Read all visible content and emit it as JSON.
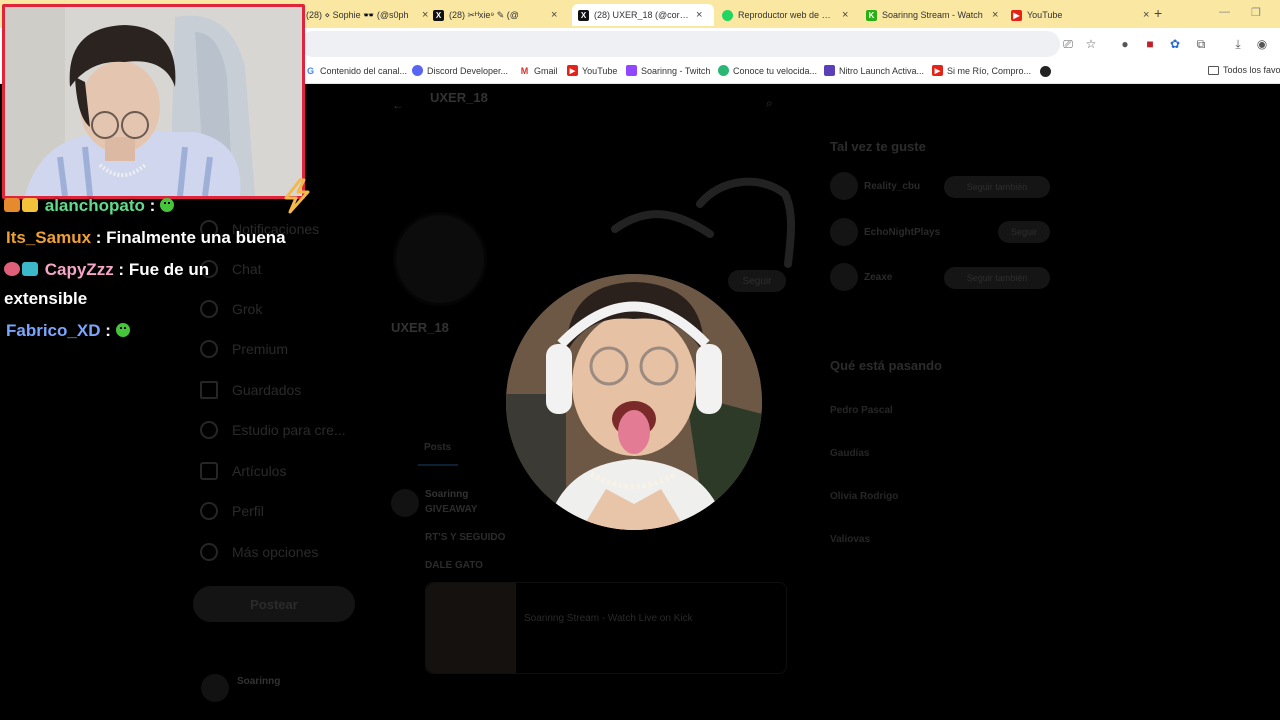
{
  "browser": {
    "tabs": [
      {
        "label": "(28) ⋄ Sophie 🕶️ (@s0ph",
        "favicon": "x-icon",
        "active": false
      },
      {
        "label": "(28) ✂︎ᴴxie⁹ ✎ (@",
        "favicon": "x-icon",
        "active": false
      },
      {
        "label": "(28) UXER_18 (@correa_u",
        "favicon": "x-icon",
        "active": true
      },
      {
        "label": "Reproductor web de Spo",
        "favicon": "spotify-icon",
        "active": false
      },
      {
        "label": "Soarinng Stream - Watch",
        "favicon": "kick-icon",
        "active": false
      },
      {
        "label": "YouTube",
        "favicon": "youtube-icon",
        "active": false
      }
    ],
    "bookmarks": [
      {
        "label": "Contenido del canal...",
        "favicon": "google-icon"
      },
      {
        "label": "Discord Developer...",
        "favicon": "discord-icon"
      },
      {
        "label": "Gmail",
        "favicon": "gmail-icon"
      },
      {
        "label": "YouTube",
        "favicon": "youtube-icon"
      },
      {
        "label": "Soarinng - Twitch",
        "favicon": "twitch-icon"
      },
      {
        "label": "Conoce tu velocida...",
        "favicon": "speedtest-icon"
      },
      {
        "label": "Nitro Launch Activa...",
        "favicon": "nitro-icon"
      },
      {
        "label": "Si me Río, Compro...",
        "favicon": "youtube-icon"
      },
      {
        "label": "Todos los favor",
        "favicon": "folder-icon"
      }
    ]
  },
  "profile_page": {
    "header_name": "UXER_18",
    "display_name": "UXER_18",
    "follow_label": "Seguir",
    "tab_posts": "Posts",
    "nav": [
      {
        "label": "Notificaciones",
        "icon": "bell-icon"
      },
      {
        "label": "Chat",
        "icon": "chat-icon"
      },
      {
        "label": "Grok",
        "icon": "grok-icon"
      },
      {
        "label": "Premium",
        "icon": "x-premium-icon"
      },
      {
        "label": "Guardados",
        "icon": "bookmark-icon"
      },
      {
        "label": "Estudio para cre...",
        "icon": "studio-icon"
      },
      {
        "label": "Artículos",
        "icon": "article-icon"
      },
      {
        "label": "Perfil",
        "icon": "person-icon"
      },
      {
        "label": "Más opciones",
        "icon": "more-icon"
      }
    ],
    "post_button": "Postear",
    "account_name": "Soarinng",
    "pinned_author": "Soarinng",
    "pinned_line1": "GIVEAWAY",
    "pinned_line2": "RT'S Y SEGUIDO",
    "pinned_line3": "DALE GATO",
    "card_title": "Soarinng Stream - Watch Live on Kick",
    "may_like_title": "Tal vez te guste",
    "suggestions": [
      {
        "name": "Reality_cbu",
        "button": "Seguir también"
      },
      {
        "name": "EchoNightPlays",
        "button": "Seguir"
      },
      {
        "name": "Zeaxe",
        "button": "Seguir también"
      }
    ],
    "whats_happening_title": "Qué está pasando",
    "trends": [
      "Pedro Pascal",
      "Gaudías",
      "Olivia Rodrigo",
      "Valiovas"
    ]
  },
  "chat": {
    "messages": [
      {
        "user": "alanchopato",
        "separator": " :",
        "text": "",
        "user_color": "#5fdc8b",
        "badges": [
          "badge-a",
          "badge-b"
        ],
        "emote": true
      },
      {
        "user": "Its_Samux",
        "separator": " :",
        "text": " Finalmente una buena",
        "user_color": "#f0a030",
        "badges": [],
        "emote": false
      },
      {
        "user": "CapyZzz",
        "separator": " :",
        "text": " Fue de un",
        "continuation": "extensible",
        "user_color": "#f6a5c7",
        "badges": [
          "badge-c",
          "badge-d"
        ],
        "emote": false
      },
      {
        "user": "Fabrico_XD",
        "separator": " :",
        "text": "",
        "user_color": "#7aa6ff",
        "badges": [],
        "emote": true
      }
    ]
  },
  "colors": {
    "chrome_tabstrip": "#f9e7a2",
    "webcam_border": "#e0243c",
    "accent_bolt": "#f3b94a"
  }
}
